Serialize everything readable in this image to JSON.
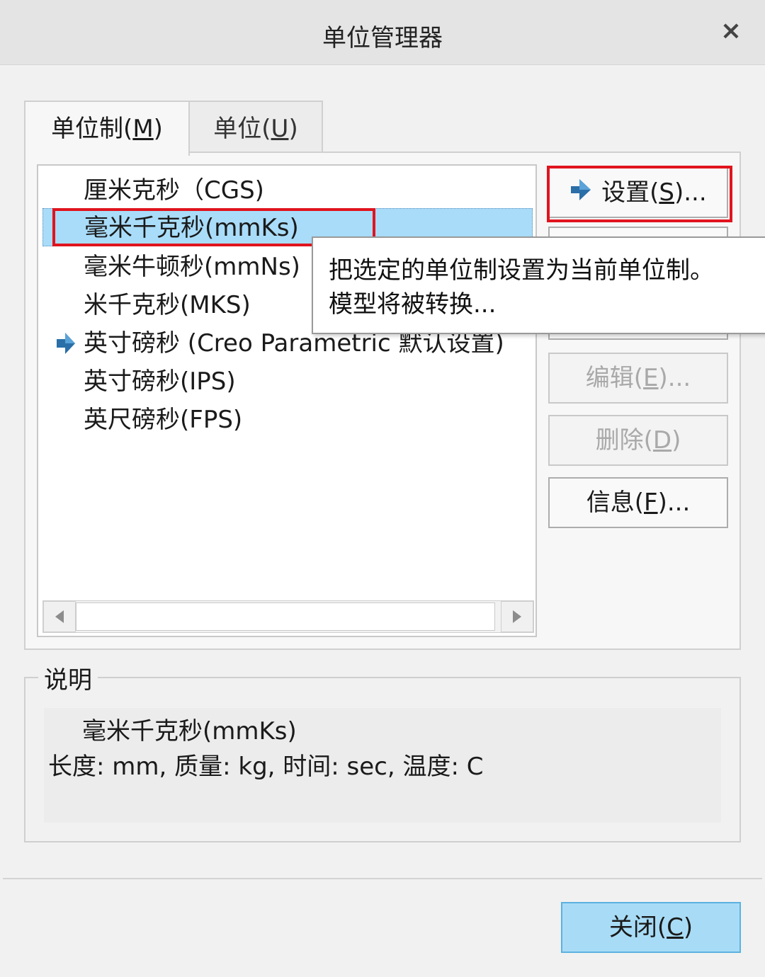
{
  "window": {
    "title": "单位管理器",
    "close_icon": "×"
  },
  "tabs": [
    {
      "label": "单位制(",
      "mnemonic": "M",
      "suffix": ")",
      "active": true
    },
    {
      "label": "单位(",
      "mnemonic": "U",
      "suffix": ")",
      "active": false
    }
  ],
  "unit_systems": [
    {
      "label": "厘米克秒（CGS)",
      "current": false,
      "selected": false
    },
    {
      "label": "毫米千克秒(mmKs)",
      "current": false,
      "selected": true
    },
    {
      "label": "毫米牛顿秒(mmNs)",
      "current": false,
      "selected": false
    },
    {
      "label": "米千克秒(MKS)",
      "current": false,
      "selected": false
    },
    {
      "label": "英寸磅秒 (Creo Parametric 默认设置)",
      "current": true,
      "selected": false
    },
    {
      "label": "英寸磅秒(IPS)",
      "current": false,
      "selected": false
    },
    {
      "label": "英尺磅秒(FPS)",
      "current": false,
      "selected": false
    }
  ],
  "buttons": {
    "set": {
      "label": "设置(",
      "mnemonic": "S",
      "suffix": ")...",
      "enabled": true
    },
    "edit": {
      "label": "编辑(",
      "mnemonic": "E",
      "suffix": ")...",
      "enabled": false
    },
    "delete": {
      "label": "删除(",
      "mnemonic": "D",
      "suffix": ")",
      "enabled": false
    },
    "info": {
      "label": "信息(",
      "mnemonic": "F",
      "suffix": ")...",
      "enabled": true
    },
    "close": {
      "label": "关闭(",
      "mnemonic": "C",
      "suffix": ")",
      "enabled": true
    }
  },
  "tooltip": {
    "line1": "把选定的单位制设置为当前单位制。",
    "line2": "模型将被转换..."
  },
  "description": {
    "legend": "说明",
    "line1": "毫米千克秒(mmKs)",
    "line2": "长度: mm, 质量: kg, 时间: sec, 温度: C"
  },
  "colors": {
    "selection": "#a9dcf9",
    "highlight_box": "#e0141e",
    "arrow": "#2a6fa8",
    "close_button": "#a8dcf6"
  },
  "icons": {
    "current_marker": "arrow-right-icon",
    "scroll_left": "triangle-left-icon",
    "scroll_right": "triangle-right-icon"
  }
}
